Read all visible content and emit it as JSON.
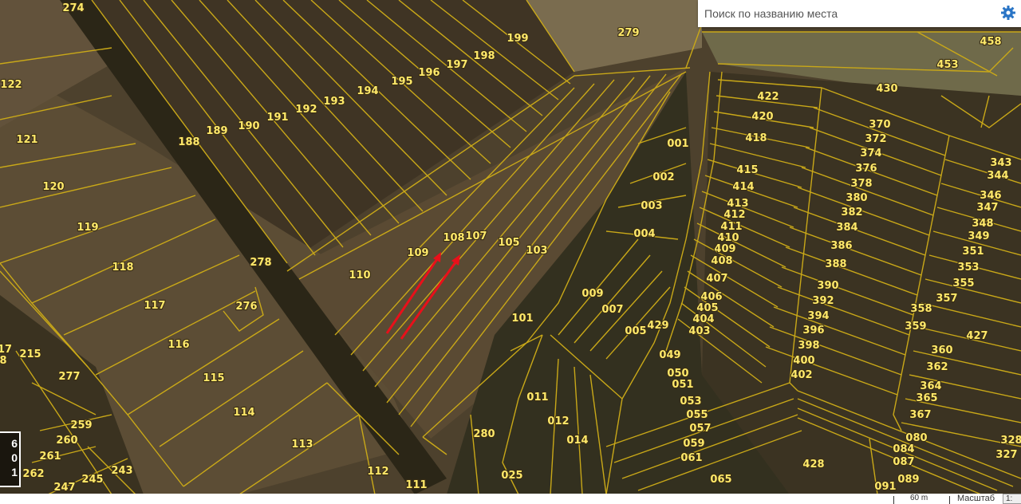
{
  "search": {
    "placeholder": "Поиск по названию места"
  },
  "legend": {
    "values": [
      "6",
      "0",
      "1"
    ]
  },
  "scale": {
    "distance": "60 m",
    "label": "Масштаб",
    "value": "1:"
  },
  "colors": {
    "parcel_border": "#c9a818",
    "parcel_label": "#ffe96a",
    "arrow": "#e8101a",
    "gear": "#2a75c6"
  },
  "parcels": [
    "274",
    "199",
    "279",
    "458",
    "453",
    "122",
    "188",
    "189",
    "190",
    "191",
    "192",
    "193",
    "194",
    "195",
    "196",
    "197",
    "198",
    "430",
    "422",
    "420",
    "418",
    "415",
    "414",
    "413",
    "412",
    "411",
    "410",
    "409",
    "408",
    "407",
    "406",
    "405",
    "404",
    "403",
    "370",
    "372",
    "374",
    "376",
    "378",
    "380",
    "382",
    "384",
    "386",
    "388",
    "390",
    "392",
    "394",
    "396",
    "398",
    "400",
    "402",
    "343",
    "344",
    "346",
    "347",
    "348",
    "349",
    "351",
    "353",
    "355",
    "357",
    "358",
    "359",
    "360",
    "362",
    "364",
    "365",
    "367",
    "427",
    "001",
    "002",
    "003",
    "004",
    "121",
    "120",
    "119",
    "118",
    "117",
    "116",
    "115",
    "114",
    "113",
    "112",
    "111",
    "278",
    "276",
    "110",
    "109",
    "108",
    "107",
    "105",
    "103",
    "101",
    "009",
    "007",
    "005",
    "429",
    "049",
    "050",
    "051",
    "053",
    "055",
    "057",
    "059",
    "061",
    "065",
    "011",
    "012",
    "014",
    "025",
    "280",
    "080",
    "084",
    "087",
    "089",
    "091",
    "428",
    "327",
    "328",
    "215",
    "277",
    "259",
    "260",
    "261",
    "262",
    "243",
    "245",
    "247",
    "17",
    "8"
  ]
}
